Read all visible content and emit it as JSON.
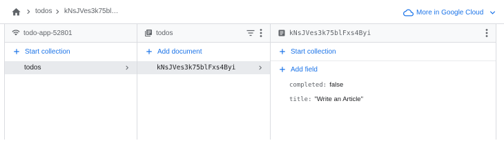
{
  "breadcrumb": {
    "items": [
      "todos",
      "kNsJVes3k75bl…"
    ]
  },
  "cloud_link": {
    "label": "More in Google Cloud"
  },
  "panels": {
    "project": {
      "title": "todo-app-52801",
      "action": "Start collection",
      "items": [
        {
          "label": "todos",
          "selected": true
        }
      ]
    },
    "collection": {
      "title": "todos",
      "action": "Add document",
      "items": [
        {
          "label": "kNsJVes3k75blFxs4Byi",
          "selected": true
        }
      ]
    },
    "document": {
      "title": "kNsJVes3k75blFxs4Byi",
      "action_collection": "Start collection",
      "action_field": "Add field",
      "fields": [
        {
          "key": "completed:",
          "value": "false"
        },
        {
          "key": "title:",
          "value": "\"Write an Article\""
        }
      ]
    }
  },
  "colors": {
    "accent": "#1a73e8",
    "border": "#dadce0",
    "header_bg": "#f8f9fa",
    "selected_bg": "#e8eaed"
  },
  "icons": [
    "home-icon",
    "chevron-right-icon",
    "cloud-icon",
    "chevron-down-icon",
    "database-icon",
    "collection-icon",
    "document-icon",
    "filter-icon",
    "more-vert-icon",
    "add-icon"
  ]
}
